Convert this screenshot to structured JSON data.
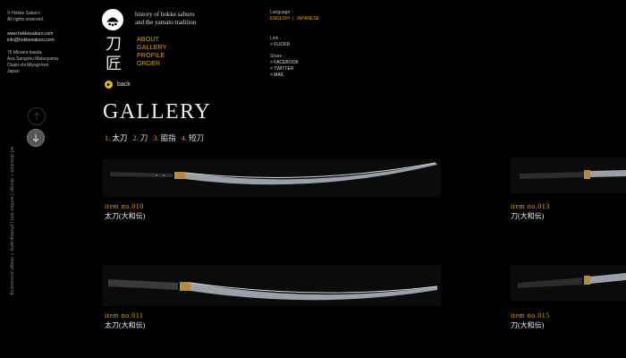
{
  "left": {
    "copyright": [
      "© Hokke Saburo",
      "All rights reserved."
    ],
    "contact": [
      "www.hokkesaburo.com",
      "info@hokkesaburo.com"
    ],
    "address": [
      "76 Minami-kaeda",
      "Aza Sangoku Matsuyama",
      "Osaki-shi Miyagi-ken",
      "Japan"
    ],
    "vertical_credit": "art direction + design | written text | photography + image processing"
  },
  "logo": {
    "kanji": [
      "刀",
      "匠"
    ],
    "tagline": [
      "history of hokke saburo",
      "and the yamato tradition"
    ]
  },
  "nav": [
    "ABOUT",
    "GALLERY",
    "PROFILE",
    "ORDER"
  ],
  "language": {
    "label": "Language :",
    "options": [
      "ENGLISH",
      "JAPANESE"
    ],
    "separator": "|"
  },
  "links": {
    "label": "Link :",
    "items": [
      "> FLICKR"
    ]
  },
  "share": {
    "label": "Share :",
    "items": [
      "> FACEBOOK",
      "> TWITTER",
      "> MAIL"
    ]
  },
  "back_label": "back",
  "page_title": "GALLERY",
  "categories": [
    {
      "num": "1.",
      "label": "太刀"
    },
    {
      "num": "2.",
      "label": "刀"
    },
    {
      "num": "3.",
      "label": "脇指"
    },
    {
      "num": "4.",
      "label": "短刀"
    }
  ],
  "items": [
    {
      "number": "item no.010",
      "name": "太刀(大和伝)"
    },
    {
      "number": "item no.013",
      "name": "刀(大和伝)"
    },
    {
      "number": "item no.011",
      "name": "太刀(大和伝)"
    },
    {
      "number": "item no.015",
      "name": "刀(大和伝)"
    }
  ],
  "colors": {
    "accent": "#e0a21c",
    "back_button": "#e8c21a",
    "background": "#000000"
  }
}
